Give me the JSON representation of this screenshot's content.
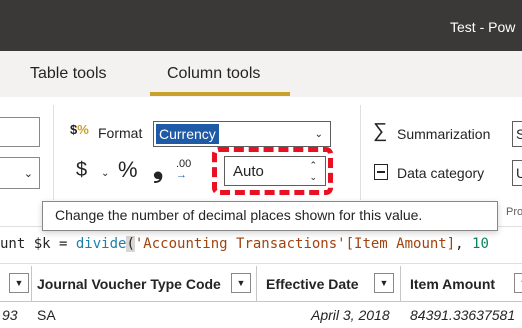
{
  "window": {
    "title": "Test - Pow"
  },
  "tabs": [
    {
      "label": "Table tools"
    },
    {
      "label": "Column tools"
    }
  ],
  "ribbon": {
    "format_icon": "$%",
    "format_label": "Format",
    "format_value": "Currency",
    "currency_symbol": "$",
    "percent_symbol": "%",
    "comma_symbol": "❟",
    "decimal_icon_text": ".00",
    "decimal_places_value": "Auto",
    "summarization_label": "Summarization",
    "summarization_value": "S",
    "data_category_label": "Data category",
    "data_category_value": "U",
    "properties_label": "Prop",
    "accent_color": "#c8a02a",
    "highlight_color": "#e81123"
  },
  "tooltip": {
    "text": "Change the number of decimal places shown for this value."
  },
  "formula": {
    "prefix": "unt $k = ",
    "function": "divide",
    "open_paren": "(",
    "reference": "'Accounting Transactions'[Item Amount]",
    "separator": ", ",
    "number": "10"
  },
  "table": {
    "columns": [
      {
        "label": "Journal Voucher Type Code"
      },
      {
        "label": "Effective Date"
      },
      {
        "label": "Item Amount"
      }
    ],
    "rows": [
      {
        "prev": "93",
        "voucher": "SA",
        "date": "April 3, 2018",
        "amount": "84391.33637581"
      }
    ]
  }
}
